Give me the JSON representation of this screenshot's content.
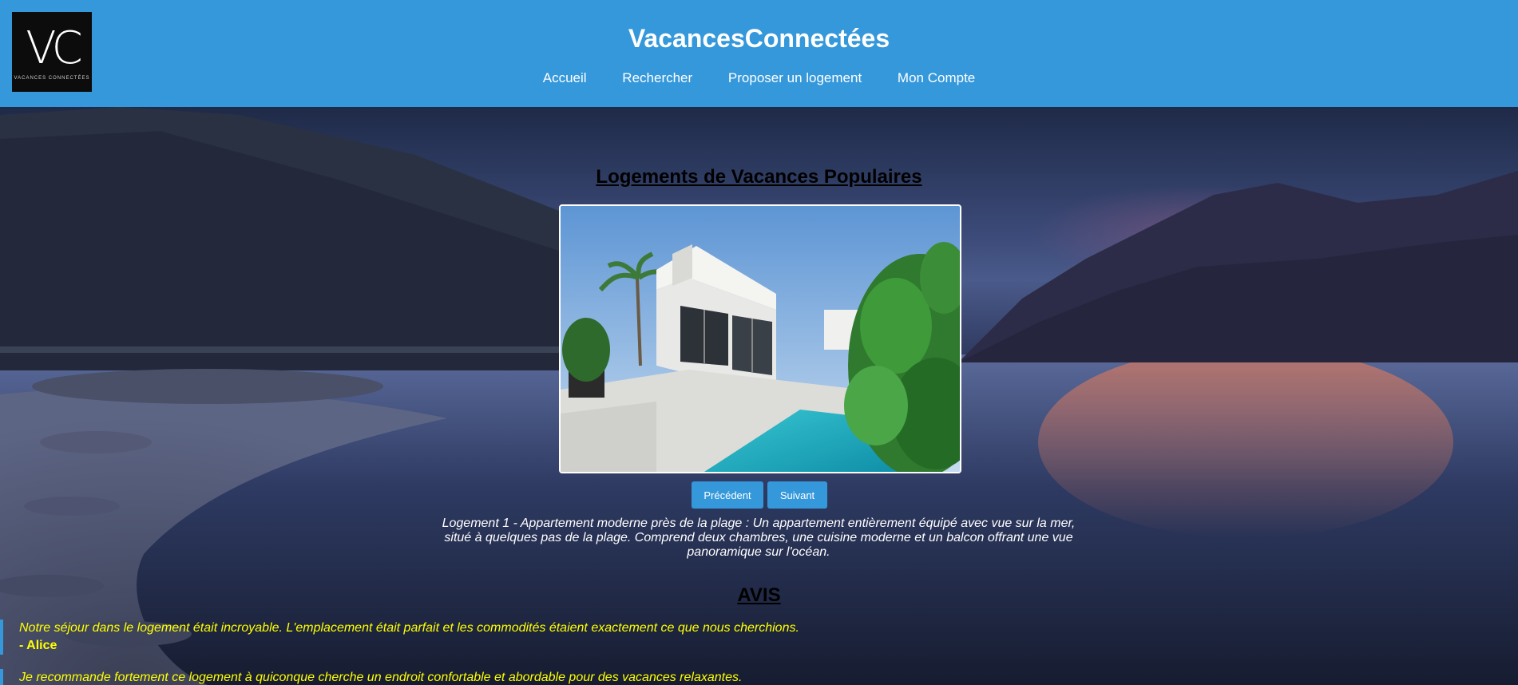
{
  "header": {
    "logo_monogram": "VC",
    "logo_subtitle": "VACANCES CONNECTÉES",
    "site_title": "VacancesConnectées",
    "nav": [
      {
        "label": "Accueil"
      },
      {
        "label": "Rechercher"
      },
      {
        "label": "Proposer un logement"
      },
      {
        "label": "Mon Compte"
      }
    ]
  },
  "main": {
    "section_title": "Logements de Vacances Populaires",
    "carousel": {
      "prev_label": "Précédent",
      "next_label": "Suivant",
      "description": "Logement 1 - Appartement moderne près de la plage : Un appartement entièrement équipé avec vue sur la mer, situé à quelques pas de la plage. Comprend deux chambres, une cuisine moderne et un balcon offrant une vue panoramique sur l'océan."
    },
    "reviews_title": "AVIS",
    "reviews": [
      {
        "text": "Notre séjour dans le logement était incroyable. L'emplacement était parfait et les commodités étaient exactement ce que nous cherchions.",
        "author": "- Alice"
      },
      {
        "text": "Je recommande fortement ce logement à quiconque cherche un endroit confortable et abordable pour des vacances relaxantes.",
        "author": ""
      }
    ]
  },
  "colors": {
    "brand": "#3498db",
    "review_text": "#ffff00"
  }
}
